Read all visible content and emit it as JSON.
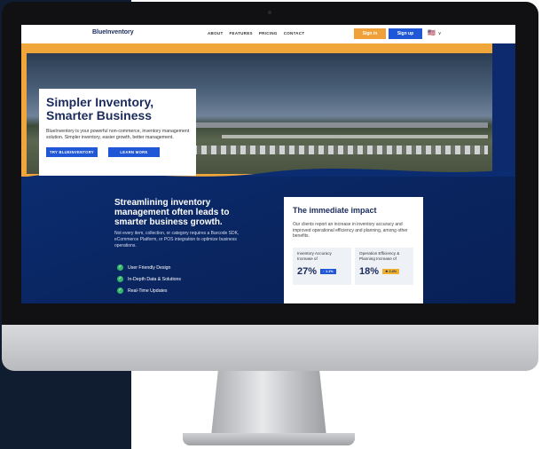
{
  "nav": {
    "logo": "BlueInventory",
    "links": [
      "ABOUT",
      "FEATURES",
      "PRICING",
      "CONTACT"
    ],
    "sign_in": "Sign in",
    "sign_up": "Sign up",
    "language": "🇺🇸"
  },
  "hero": {
    "title": "Simpler Inventory, Smarter Business",
    "description": "BlueInventory is your powerful non-commerce, inventory management solution. Simpler inventory, easier growth, better management.",
    "primary_button": "TRY BLUEINVENTORY",
    "secondary_button": "LEARN MORE"
  },
  "growth": {
    "title": "Streamlining inventory management often leads to smarter business growth.",
    "description": "Not every item, collection, or category requires a Barcode SDK, eCommerce Platform, or POS integration to optimize business operations.",
    "bullets": [
      "User Friendly Design",
      "In-Depth Data & Solutions",
      "Real-Time Updates"
    ]
  },
  "impact": {
    "title": "The immediate impact",
    "description": "Our clients report an increase in inventory accuracy and improved operational efficiency and planning, among other benefits.",
    "stats": [
      {
        "label": "Inventory Accuracy Increase of",
        "value": "27%",
        "badge": "↑ 1.1%"
      },
      {
        "label": "Operation Efficiency & Planning Increase of",
        "value": "18%",
        "badge": "★ 2.4%"
      }
    ]
  },
  "colors": {
    "brand_navy": "#1a2b5c",
    "accent_blue": "#1f57d6",
    "accent_orange": "#f0a13a",
    "success_green": "#35b86a"
  },
  "icons": {
    "apple": "apple-logo-icon",
    "check": "check-circle-icon",
    "chevron": "chevron-down-icon"
  }
}
